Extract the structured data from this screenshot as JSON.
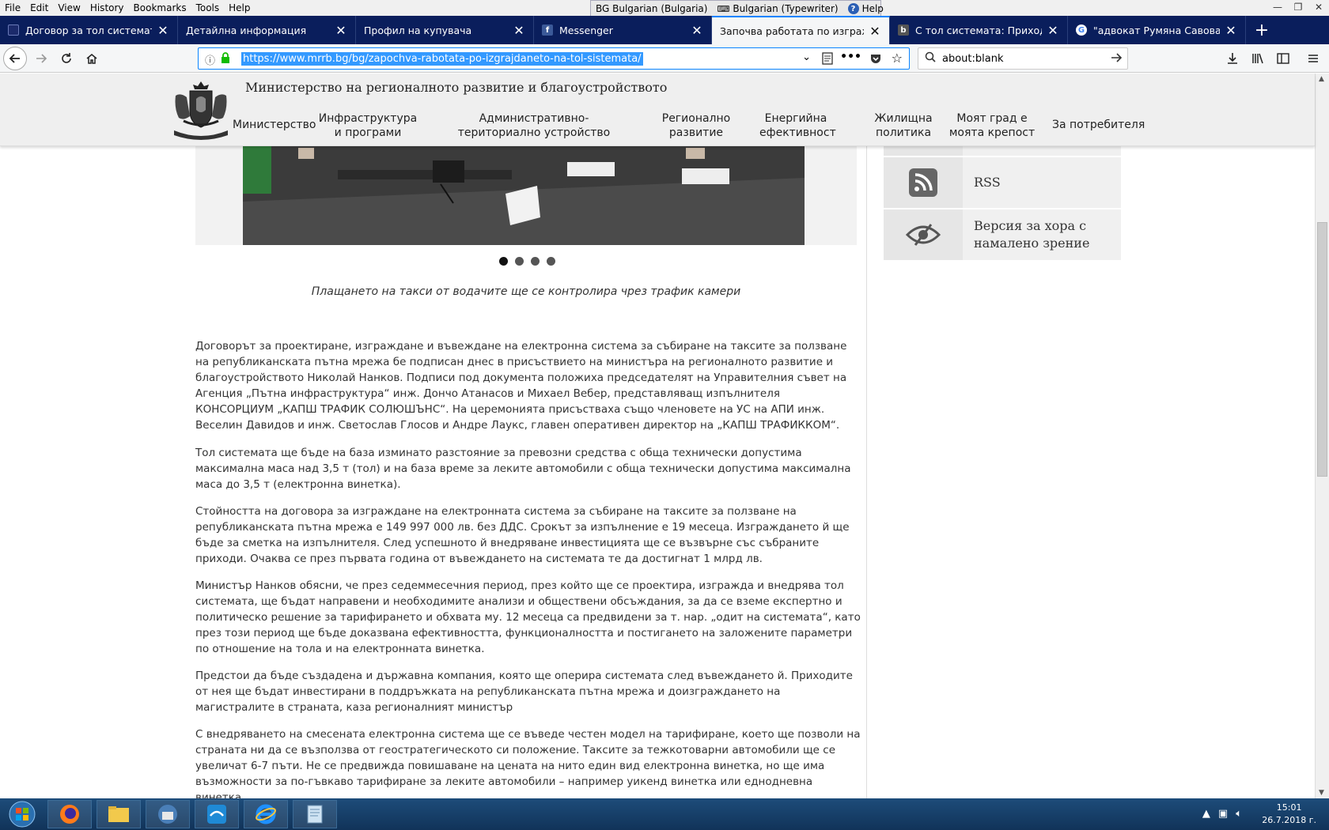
{
  "menu": [
    "File",
    "Edit",
    "View",
    "History",
    "Bookmarks",
    "Tools",
    "Help"
  ],
  "language_bar": {
    "input_lang": "BG Bulgarian (Bulgaria)",
    "keyboard": "Bulgarian (Typewriter)",
    "help": "Help"
  },
  "tabs": [
    {
      "title": "Договор за тол системата без",
      "icon": "page-icon",
      "active": false
    },
    {
      "title": "Детайлна информация",
      "icon": "none",
      "active": false
    },
    {
      "title": "Профил на купувача",
      "icon": "none",
      "active": false
    },
    {
      "title": "Messenger",
      "icon": "facebook-icon",
      "active": false
    },
    {
      "title": "Започва работата по изграждането",
      "icon": "none",
      "active": true
    },
    {
      "title": "С тол системата: Приходите от",
      "icon": "b-icon",
      "active": false
    },
    {
      "title": "\"адвокат Румяна Савова Дим",
      "icon": "google-icon",
      "active": false
    }
  ],
  "navbar": {
    "url": "https://www.mrrb.bg/bg/zapochva-rabotata-po-izgrajdaneto-na-tol-sistemata/",
    "search_value": "about:blank"
  },
  "site": {
    "title": "Министерство на регионалното развитие и благоустройството",
    "nav": [
      {
        "label": "Министерство"
      },
      {
        "label": "Инфраструктура и програми"
      },
      {
        "label": "Административно-териториално устройство"
      },
      {
        "label": "Регионално развитие"
      },
      {
        "label": "Енергийна ефективност"
      },
      {
        "label": "Жилищна политика"
      },
      {
        "label": "Моят град е моята крепост"
      },
      {
        "label": "За потребителя"
      }
    ]
  },
  "article": {
    "caption": "Плащането на такси от водачите ще се контролира чрез трафик камери",
    "paragraphs": [
      "Договорът за проектиране, изграждане и въвеждане на електронна система за събиране на таксите за ползване на републиканската пътна мрежа бе подписан днес в присъствието на министъра на регионалното развитие и благоустройството Николай Нанков. Подписи под документа положиха председателят на Управителния съвет на Агенция „Пътна инфраструктура“ инж. Дончо Атанасов и Михаел Вебер, представляващ изпълнителя КОНСОРЦИУМ „КАПШ ТРАФИК СОЛЮШЪНС“. На церемонията присъстваха също членовете на УС на АПИ инж. Веселин Давидов и инж. Светослав Глосов и Андре Лаукс, главен оперативен директор на „КАПШ ТРАФИККОМ“.",
      "Тол системата ще бъде на база изминато разстояние за превозни средства с обща технически допустима максимална маса над 3,5 т (тол) и на база време за леките автомобили с обща технически допустима максимална маса до 3,5 т (електронна винетка).",
      "Стойността на договора за изграждане на електронната система за събиране на таксите за ползване на републиканската пътна мрежа е 149 997 000 лв. без ДДС. Срокът за изпълнение е 19 месеца. Изграждането й ще бъде за сметка на изпълнителя. След успешното й внедряване инвестицията ще се възвърне със събраните приходи. Очаква се през първата година от въвеждането на системата те да достигнат 1 млрд лв.",
      "Министър Нанков обясни, че през седеммесечния период, през който ще се проектира, изгражда и внедрява тол системата, ще бъдат направени и необходимите анализи и обществени обсъждания, за да се вземе експертно и политическо решение за тарифирането и обхвата му. 12 месеца са предвидени за т. нар. „одит на системата“, като през този период ще бъде доказвана ефективността, функционалността и постигането на заложените параметри по отношение на тола и на електронната винетка.",
      "Предстои да бъде създадена и държавна компания, която ще оперира системата след въвеждането й. Приходите от нея ще бъдат инвестирани в поддръжката на републиканската пътна мрежа и доизграждането на магистралите в страната, каза регионалният министър",
      "С внедряването на смесената електронна система ще се въведе честен модел на тарифиране, което ще позволи на страната ни да се възползва от геостратегическото си положение. Таксите за тежкотоварни автомобили ще се увеличат 6-7 пъти. Не се предвижда повишаване на цената на нито един вид електронна винетка, но ще има възможности за по-гъвкаво тарифиране за леките автомобили – например уикенд винетка или еднодневна винетка."
    ]
  },
  "sidebar": {
    "items": [
      {
        "label": "RSS",
        "icon": "rss-icon"
      },
      {
        "label": "Версия за хора с намалено зрение",
        "icon": "eye-slash-icon"
      }
    ]
  },
  "taskbar": {
    "time": "15:01",
    "date": "26.7.2018 г."
  }
}
